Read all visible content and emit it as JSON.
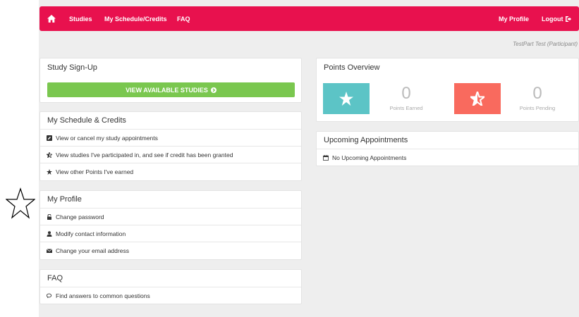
{
  "nav": {
    "studies": "Studies",
    "schedule": "My Schedule/Credits",
    "faq": "FAQ",
    "profile": "My Profile",
    "logout": "Logout"
  },
  "user_label": "TestPart Test (Participant)",
  "signup": {
    "title": "Study Sign-Up",
    "button": "VIEW AVAILABLE STUDIES"
  },
  "schedule": {
    "title": "My Schedule & Credits",
    "items": [
      {
        "label": "View or cancel my study appointments",
        "icon": "edit-icon"
      },
      {
        "label": "View studies I've participated in, and see if credit has been granted",
        "icon": "half-star-icon"
      },
      {
        "label": "View other Points I've earned",
        "icon": "star-icon"
      }
    ]
  },
  "profile": {
    "title": "My Profile",
    "items": [
      {
        "label": "Change password",
        "icon": "lock-icon"
      },
      {
        "label": "Modify contact information",
        "icon": "user-icon"
      },
      {
        "label": "Change your email address",
        "icon": "envelope-icon"
      }
    ]
  },
  "faq": {
    "title": "FAQ",
    "items": [
      {
        "label": "Find answers to common questions",
        "icon": "comments-icon"
      }
    ]
  },
  "points": {
    "title": "Points Overview",
    "earned_value": "0",
    "earned_label": "Points Earned",
    "pending_value": "0",
    "pending_label": "Points Pending"
  },
  "appointments": {
    "title": "Upcoming Appointments",
    "empty": "No Upcoming Appointments"
  },
  "colors": {
    "navbar": "#e8114e",
    "signup_button": "#7ac74f",
    "earned_box": "#5cc4c6",
    "pending_box": "#f96a5e"
  }
}
